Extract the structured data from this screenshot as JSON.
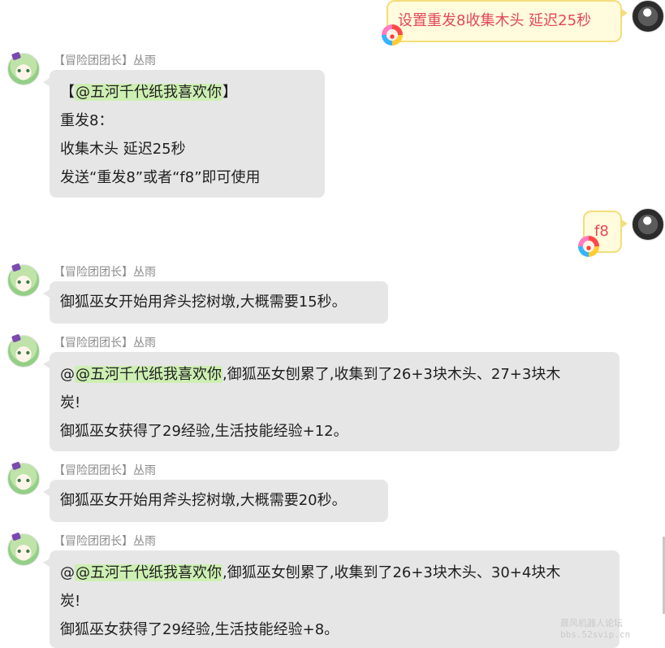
{
  "outgoing": [
    {
      "text": "设置重发8收集木头 延迟25秒"
    },
    {
      "text": "f8"
    }
  ],
  "incoming": [
    {
      "sender": "【冒险团团长】丛雨",
      "lines": [
        {
          "mention": "@五河千代纸我喜欢你",
          "prefix": "【",
          "suffix": "】"
        },
        {
          "text": "重发8："
        },
        {
          "text": "收集木头 延迟25秒"
        },
        {
          "text": "发送“重发8”或者“f8”即可使用"
        }
      ]
    },
    {
      "sender": "【冒险团团长】丛雨",
      "lines": [
        {
          "text": "御狐巫女开始用斧头挖树墩,大概需要15秒。"
        }
      ]
    },
    {
      "sender": "【冒险团团长】丛雨",
      "lines": [
        {
          "prefix": "@",
          "mention": "@五河千代纸我喜欢你",
          "suffix": ",御狐巫女刨累了,收集到了26+3块木头、27+3块木"
        },
        {
          "text": "炭!"
        },
        {
          "text": "御狐巫女获得了29经验,生活技能经验+12。"
        }
      ]
    },
    {
      "sender": "【冒险团团长】丛雨",
      "lines": [
        {
          "text": "御狐巫女开始用斧头挖树墩,大概需要20秒。"
        }
      ]
    },
    {
      "sender": "【冒险团团长】丛雨",
      "lines": [
        {
          "prefix": "@",
          "mention": "@五河千代纸我喜欢你",
          "suffix": ",御狐巫女刨累了,收集到了26+3块木头、30+4块木"
        },
        {
          "text": "炭!"
        },
        {
          "text": "御狐巫女获得了29经验,生活技能经验+8。"
        }
      ]
    }
  ],
  "watermark": {
    "line1": "晨风机器人论坛",
    "line2": "bbs.52svip.cn"
  },
  "colors": {
    "outgoing_text": "#e4475c",
    "outgoing_bg": "#fffbdc",
    "outgoing_border": "#f4dd7a",
    "incoming_bg": "#e6e6e6",
    "mention_bg": "#cdefb3"
  }
}
